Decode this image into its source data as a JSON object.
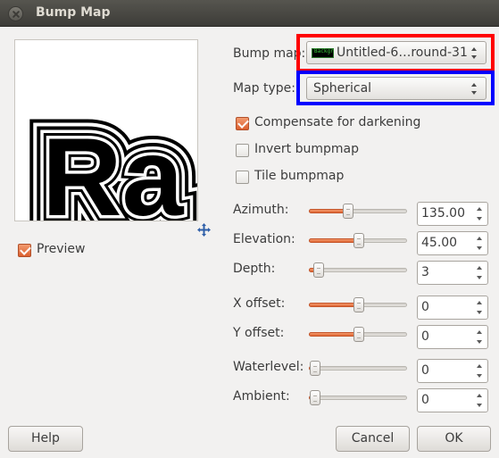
{
  "window": {
    "title": "Bump Map"
  },
  "preview": {
    "label": "Preview",
    "checked": true,
    "image_text": "Ra"
  },
  "bump_map": {
    "label": "Bump map:",
    "value": "Untitled-6…round-31",
    "thumb_text": "Backgr"
  },
  "map_type": {
    "label": "Map type:",
    "value": "Spherical"
  },
  "options": {
    "compensate": {
      "label": "Compensate for darkening",
      "checked": true
    },
    "invert": {
      "label": "Invert bumpmap",
      "checked": false
    },
    "tile": {
      "label": "Tile bumpmap",
      "checked": false
    }
  },
  "sliders": {
    "azimuth": {
      "label": "Azimuth:",
      "value": "135.00",
      "fraction": 0.375
    },
    "elevation": {
      "label": "Elevation:",
      "value": "45.00",
      "fraction": 0.5
    },
    "depth": {
      "label": "Depth:",
      "value": "3",
      "fraction": 0.04
    },
    "x_offset": {
      "label": "X offset:",
      "value": "0",
      "fraction": 0.5
    },
    "y_offset": {
      "label": "Y offset:",
      "value": "0",
      "fraction": 0.5
    },
    "waterlevel": {
      "label": "Waterlevel:",
      "value": "0",
      "fraction": 0.0
    },
    "ambient": {
      "label": "Ambient:",
      "value": "0",
      "fraction": 0.0
    }
  },
  "buttons": {
    "help": "Help",
    "cancel": "Cancel",
    "ok": "OK"
  },
  "colors": {
    "accent": "#df6632",
    "highlight_red": "#ff0000",
    "highlight_blue": "#0000ff"
  }
}
